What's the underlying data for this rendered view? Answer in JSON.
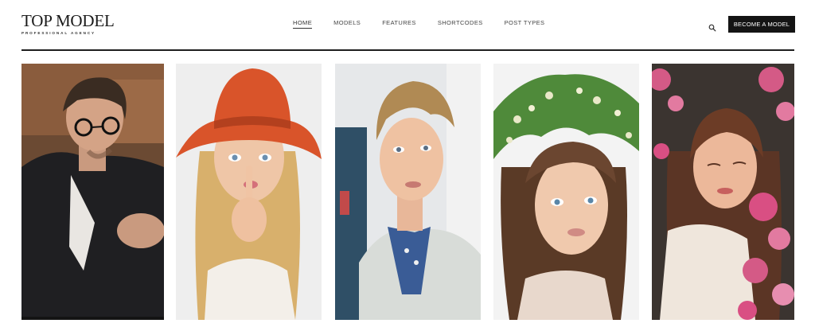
{
  "brand": {
    "title": "TOP MODEL",
    "subtitle": "PROFESSIONAL AGENCY"
  },
  "nav": {
    "items": [
      {
        "label": "HOME",
        "active": true
      },
      {
        "label": "MODELS"
      },
      {
        "label": "FEATURES"
      },
      {
        "label": "SHORTCODES"
      },
      {
        "label": "POST TYPES"
      }
    ]
  },
  "header": {
    "search_icon": "search-icon",
    "cta_label": "BECOME A MODEL"
  },
  "colors": {
    "cta_bg": "#141414",
    "rule": "#1e1e1e"
  },
  "gallery": {
    "photos": [
      {
        "subject": "man with glasses in black jacket"
      },
      {
        "subject": "blonde woman in orange hat, finger on lips"
      },
      {
        "subject": "young man in light blazer"
      },
      {
        "subject": "woman with flower wreath"
      },
      {
        "subject": "woman among pink blossoms"
      }
    ]
  }
}
